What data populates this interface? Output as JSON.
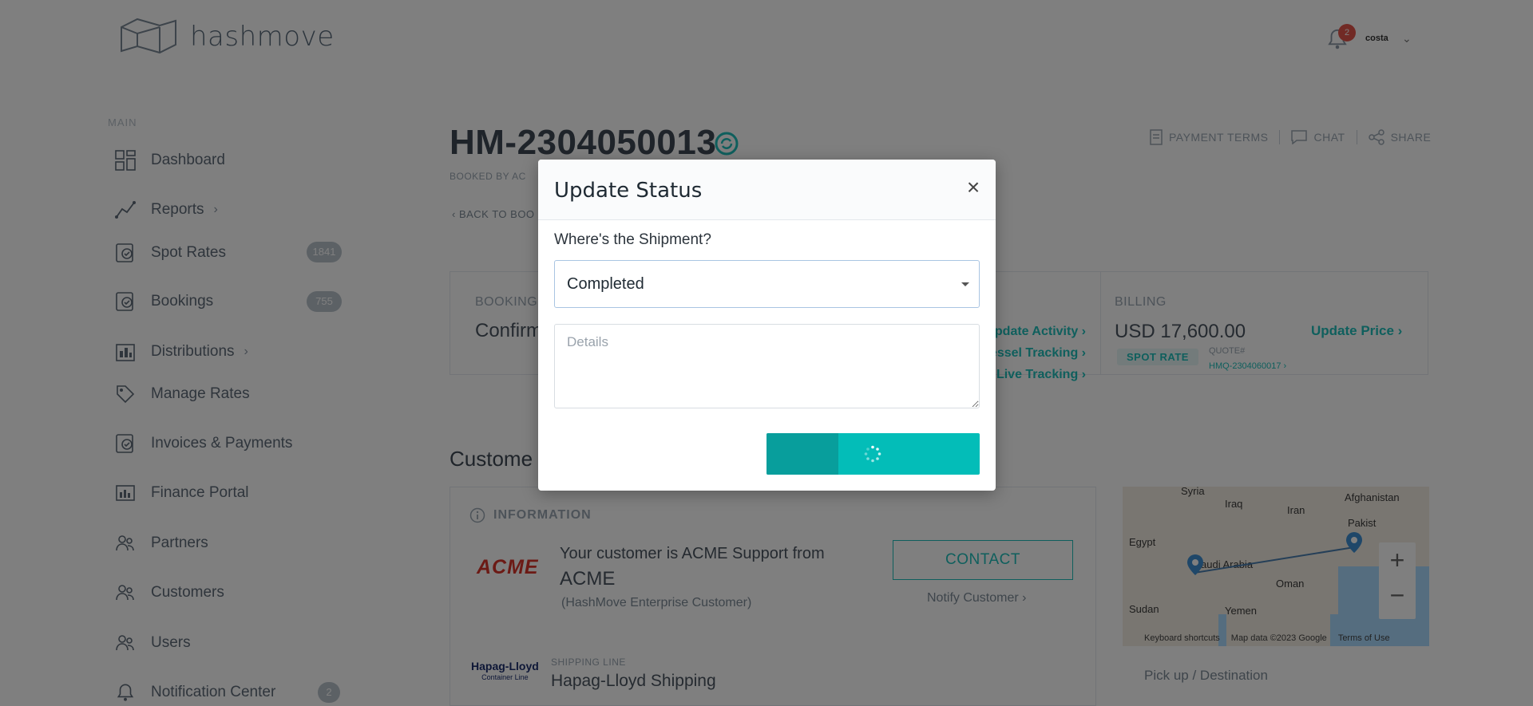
{
  "header": {
    "brand": "hashmove",
    "notification_count": "2",
    "user_logo": "costa"
  },
  "sidebar": {
    "section": "MAIN",
    "items": [
      {
        "label": "Dashboard",
        "icon": "dashboard-icon"
      },
      {
        "label": "Reports",
        "icon": "reports-icon",
        "chevron": "›"
      },
      {
        "label": "Spot Rates",
        "icon": "spot-rates-icon",
        "badge": "1841"
      },
      {
        "label": "Bookings",
        "icon": "bookings-icon",
        "badge": "755"
      },
      {
        "label": "Distributions",
        "icon": "distributions-icon",
        "chevron": "›"
      },
      {
        "label": "Manage Rates",
        "icon": "tag-icon"
      },
      {
        "label": "Invoices & Payments",
        "icon": "invoice-icon"
      },
      {
        "label": "Finance Portal",
        "icon": "finance-icon"
      },
      {
        "label": "Partners",
        "icon": "partners-icon"
      },
      {
        "label": "Customers",
        "icon": "customers-icon"
      },
      {
        "label": "Users",
        "icon": "users-icon"
      },
      {
        "label": "Notification Center",
        "icon": "bell-icon",
        "badge": "2"
      }
    ]
  },
  "page": {
    "booking_id": "HM-2304050013",
    "booked_by": "BOOKED BY AC",
    "back_link": "‹ BACK TO BOO",
    "actions": {
      "payment_terms": "PAYMENT TERMS",
      "chat": "CHAT",
      "share": "SHARE"
    }
  },
  "booking": {
    "label": "BOOKING",
    "value": "Confirm",
    "links": [
      "Update Activity ›",
      "Vessel Tracking ›",
      "Live Tracking ›"
    ]
  },
  "billing": {
    "label": "BILLING",
    "amount": "USD 17,600.00",
    "update_price": "Update Price ›",
    "spot_rate": "SPOT RATE",
    "quote_label": "QUOTE#",
    "quote_value": "HMQ-2304060017 ›"
  },
  "customer": {
    "section_title": "Custome",
    "info_head": "INFORMATION",
    "logo": "ACME",
    "text": "Your customer is ACME Support from",
    "name": "ACME",
    "sub": "(HashMove Enterprise Customer)",
    "contact": "CONTACT",
    "notify": "Notify Customer ›",
    "shipping_label": "SHIPPING LINE",
    "shipping_value": "Hapag-Lloyd Shipping",
    "shipping_logo": "Hapag-Lloyd",
    "shipping_logo_sub": "Container Line"
  },
  "map": {
    "labels": [
      "Syria",
      "Iraq",
      "Iran",
      "Afghanistan",
      "Pakist",
      "Egypt",
      "audi Arabia",
      "Oman",
      "Sudan",
      "Yemen"
    ],
    "footer": [
      "Keyboard shortcuts",
      "Map data ©2023 Google",
      "Terms of Use"
    ],
    "pickup": "Pick up / Destination"
  },
  "modal": {
    "title": "Update Status",
    "question": "Where's the Shipment?",
    "selected_status": "Completed",
    "details_placeholder": "Details",
    "accent": "#03bdb8"
  }
}
